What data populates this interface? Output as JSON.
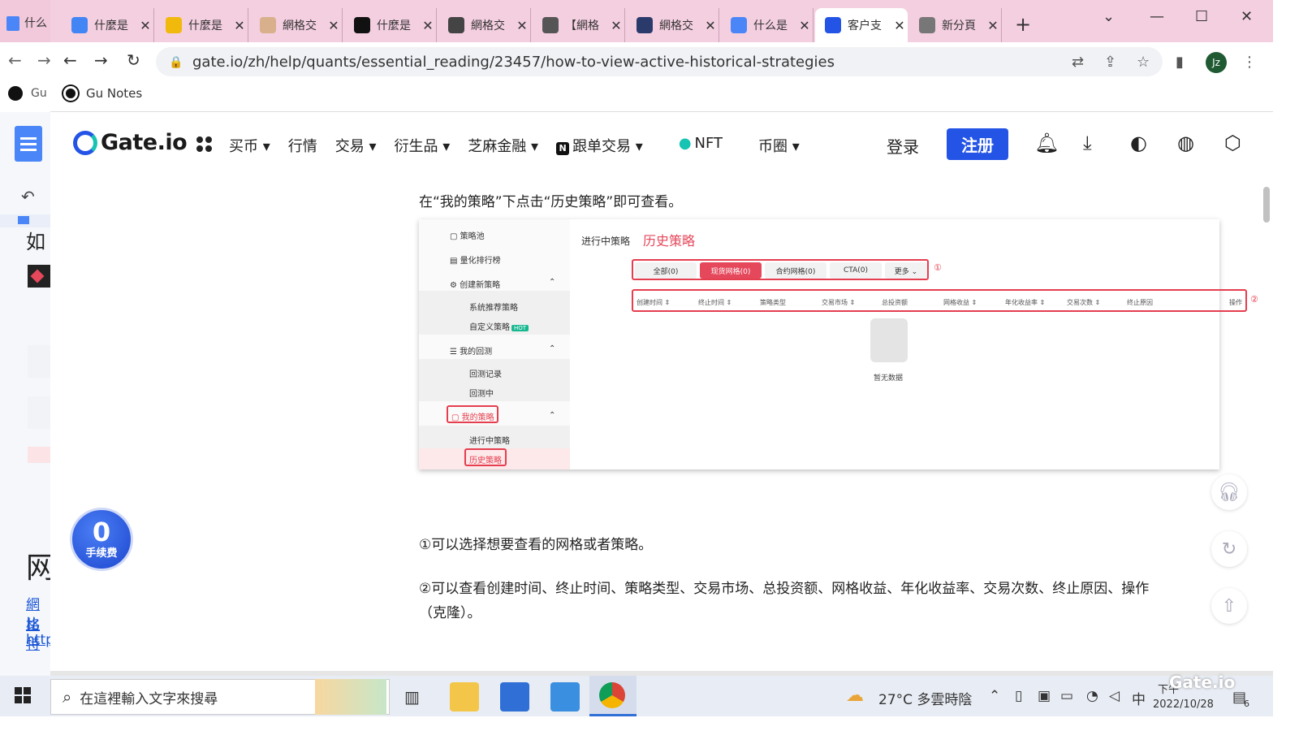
{
  "background_window": {
    "tab_title": "什么",
    "bookmark": "Gu",
    "doc_text_1": "如",
    "doc_text_2": "网",
    "links": [
      "網格",
      "比特",
      "http"
    ]
  },
  "browser": {
    "tabs": [
      {
        "title": "什麼是",
        "icon": "google-icon",
        "color": "#4285f4"
      },
      {
        "title": "什麼是",
        "icon": "binance-icon",
        "color": "#f0b90b"
      },
      {
        "title": "網格交",
        "icon": "site-icon",
        "color": "#d8b08c"
      },
      {
        "title": "什麼是",
        "icon": "medium-icon",
        "color": "#111111"
      },
      {
        "title": "網格交",
        "icon": "bird-icon",
        "color": "#444444"
      },
      {
        "title": "【網格",
        "icon": "chat-icon",
        "color": "#555555"
      },
      {
        "title": "網格交",
        "icon": "hb-icon",
        "color": "#2a3a6a"
      },
      {
        "title": "什么是",
        "icon": "docs-icon",
        "color": "#4a86f7"
      },
      {
        "title": "客户支",
        "icon": "gate-icon",
        "color": "#2354e6",
        "active": true
      },
      {
        "title": "新分頁",
        "icon": "chrome-icon",
        "color": "#777777"
      }
    ],
    "url": "gate.io/zh/help/quants/essential_reading/23457/how-to-view-active-historical-strategies",
    "avatar": "Jz",
    "bookmark": "Gu Notes"
  },
  "site": {
    "logo": "Gate.io",
    "menu": [
      "买币 ▾",
      "行情",
      "交易 ▾",
      "衍生品 ▾",
      "芝麻金融 ▾",
      "跟单交易 ▾",
      "NFT",
      "币圈 ▾"
    ],
    "login": "登录",
    "register": "注册"
  },
  "article": {
    "intro": "在“我的策略”下点击“历史策略”即可查看。",
    "note1": "①可以选择想要查看的网格或者策略。",
    "note2_line1": "②可以查看创建时间、终止时间、策略类型、交易市场、总投资额、网格收益、年化收益率、交易次数、终止原因、操作",
    "note2_line2": "（克隆）。"
  },
  "figure": {
    "sidebar": [
      "策略池",
      "量化排行榜",
      "创建新策略",
      "系统推荐策略",
      "自定义策略",
      "我的回测",
      "回测记录",
      "回测中",
      "我的策略",
      "进行中策略",
      "历史策略"
    ],
    "hot": "HOT",
    "tab_active": "进行中策略",
    "tab_history": "历史策略",
    "filters": [
      "全部(0)",
      "现货网格(0)",
      "合约网格(0)",
      "CTA(0)",
      "更多 ⌄"
    ],
    "columns": [
      "创建时间 ⇕",
      "终止时间 ⇕",
      "策略类型",
      "交易市场 ⇕",
      "总投资额",
      "网格收益 ⇕",
      "年化收益率 ⇕",
      "交易次数 ⇕",
      "终止原因",
      "操作"
    ],
    "empty": "暂无数据",
    "marker1": "①",
    "marker2": "②"
  },
  "fee_badge": {
    "number": "0",
    "label": "手续费"
  },
  "taskbar": {
    "search_placeholder": "在這裡輸入文字來搜尋",
    "weather": "27°C  多雲時陰",
    "ime": "中",
    "time": "下午",
    "date": "2022/10/28",
    "notifications": "6"
  },
  "watermark": "Gate.io"
}
